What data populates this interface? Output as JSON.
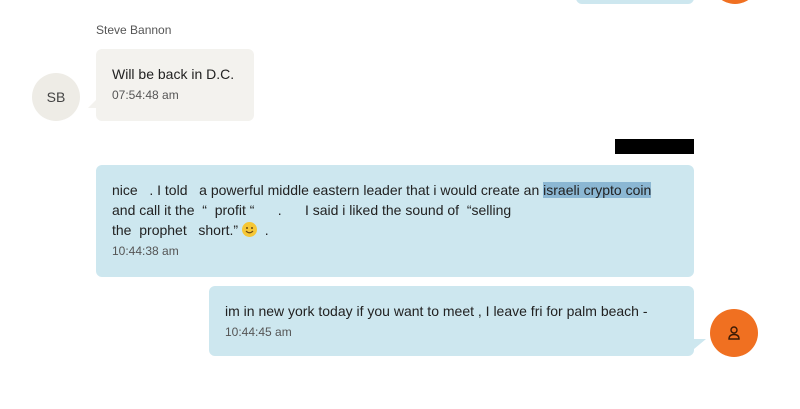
{
  "messages": [
    {
      "sender": "Steve Bannon",
      "initials": "SB",
      "text": "Will be back in D.C.",
      "time": "07:54:48 am"
    },
    {
      "line1_pre": "nice   . I told   a powerful middle eastern leader that i would create an ",
      "line1_highlight": "israeli crypto coin",
      "line2": "and call it the  “  profit “      .      I said i liked the sound of  “selling",
      "line3_pre": "the  prophet   short.” ",
      "emoji": "😊",
      "line3_post": "  .",
      "time": "10:44:38 am"
    },
    {
      "text": "im in new york  today if you want to meet  , I leave fri for palm beach -",
      "time": "10:44:45 am"
    }
  ],
  "icons": {
    "me_avatar": "user-icon",
    "emoji": "smiling-face-icon"
  },
  "colors": {
    "outgoing_bubble": "#cde7ef",
    "incoming_bubble": "#f3f2ee",
    "avatar_orange": "#f07021",
    "highlight": "#8bb7d3"
  }
}
